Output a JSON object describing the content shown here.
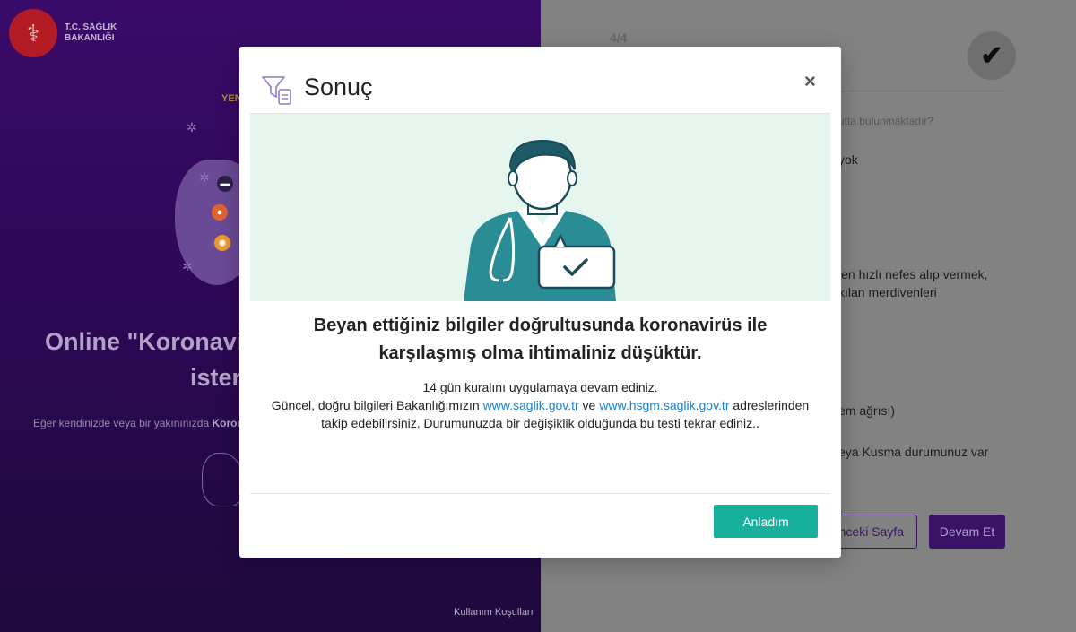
{
  "left_panel": {
    "logo_line1": "T.C. SAĞLIK",
    "logo_line2": "BAKANLIĞI",
    "yeni": "YEN",
    "title_line1": "Online \"Koronavi",
    "title_line2": "ister",
    "desc_prefix": "Eğer kendinizde veya bir yakınınızda ",
    "desc_bold": "Koron",
    "footer_link": "Kullanım Koşulları"
  },
  "right_panel": {
    "step": "4/4",
    "q1": "utta bulunmaktadır?",
    "q2": "yok",
    "q3_line1": "len hızlı nefes alıp vermek,",
    "q3_line2": "kılan merdivenleri",
    "q4": "em ağrısı)",
    "q5": "eya Kusma durumunuz var",
    "prev_button": "nceki Sayfa",
    "next_button": "Devam Et"
  },
  "modal": {
    "title": "Sonuç",
    "close": "×",
    "result_title_line1": "Beyan ettiğiniz bilgiler doğrultusunda koronavirüs ile",
    "result_title_line2": "karşılaşmış olma ihtimaliniz düşüktür.",
    "body_line1": "14 gün kuralını uygulamaya devam ediniz.",
    "body_line2_prefix": "Güncel, doğru bilgileri Bakanlığımızın ",
    "link1": "www.saglik.gov.tr",
    "body_line2_mid": " ve ",
    "link2": "www.hsgm.saglik.gov.tr",
    "body_line2_suffix": " adreslerinden",
    "body_line3": "takip edebilirsiniz. Durumunuzda bir değişiklik olduğunda bu testi tekrar ediniz..",
    "ok_button": "Anladım"
  },
  "colors": {
    "primary_purple": "#3b1366",
    "accent_teal": "#17b09c",
    "link_blue": "#1a7fd1",
    "banner_bg": "#e5f6ef"
  },
  "icons": {
    "modal_icon": "filter-document-icon",
    "close_icon": "close-icon",
    "check_icon": "check-icon",
    "logo_icon": "ministry-emblem-icon"
  }
}
